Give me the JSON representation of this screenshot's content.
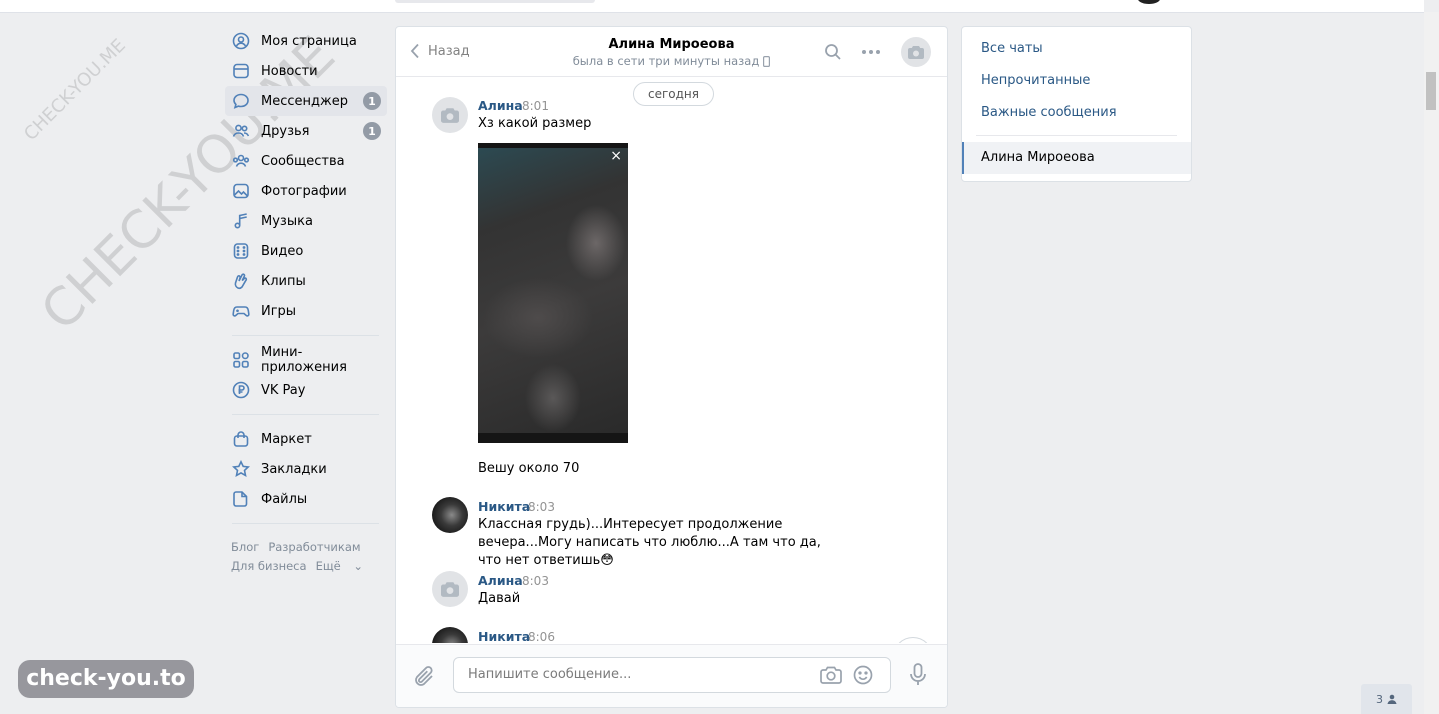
{
  "watermarks": {
    "small": "CHECK-YOU.ME",
    "large": "CHECK-YOU.ME"
  },
  "brand_overlay": "check-you.to",
  "left_nav": {
    "items": [
      {
        "label": "Моя страница",
        "icon": "user-circle-icon"
      },
      {
        "label": "Новости",
        "icon": "news-icon"
      },
      {
        "label": "Мессенджер",
        "icon": "message-bubble-icon",
        "badge": "1",
        "active": true
      },
      {
        "label": "Друзья",
        "icon": "friends-icon",
        "badge": "1"
      },
      {
        "label": "Сообщества",
        "icon": "groups-icon"
      },
      {
        "label": "Фотографии",
        "icon": "photo-icon"
      },
      {
        "label": "Музыка",
        "icon": "music-icon"
      },
      {
        "label": "Видео",
        "icon": "video-icon"
      },
      {
        "label": "Клипы",
        "icon": "clips-icon"
      },
      {
        "label": "Игры",
        "icon": "gamepad-icon"
      }
    ],
    "items2": [
      {
        "label": "Мини-приложения",
        "icon": "apps-grid-icon"
      },
      {
        "label": "VK Pay",
        "icon": "vkpay-icon"
      }
    ],
    "items3": [
      {
        "label": "Маркет",
        "icon": "bag-icon"
      },
      {
        "label": "Закладки",
        "icon": "star-icon"
      },
      {
        "label": "Файлы",
        "icon": "file-icon"
      }
    ],
    "footer": {
      "blog": "Блог",
      "developers": "Разработчикам",
      "business": "Для бизнеса",
      "more": "Ещё"
    }
  },
  "chat": {
    "back_label": "Назад",
    "peer_name": "Алина Мироеова",
    "peer_status": "была в сети три минуты назад",
    "date_divider": "сегодня",
    "messages": [
      {
        "author": "Алина",
        "time": "8:01",
        "text": "Хз какой размер",
        "text2": "Вешу около 70"
      },
      {
        "author": "Никита",
        "time": "8:03",
        "text": "Классная грудь)...Интересует продолжение вечера...Могу написать что люблю...А там что да, что нет ответишь😳"
      },
      {
        "author": "Алина",
        "time": "8:03",
        "text": "Давай"
      },
      {
        "author": "Никита",
        "time": "8:06"
      }
    ],
    "photo_close": "×",
    "composer_placeholder": "Напишите сообщение..."
  },
  "right_panel": {
    "filters": [
      "Все чаты",
      "Непрочитанные",
      "Важные сообщения"
    ],
    "selected_chat": "Алина Мироеова"
  },
  "online_count": "3",
  "colors": {
    "link": "#2a5885",
    "badge": "#939ba6",
    "background": "#edeef0"
  }
}
